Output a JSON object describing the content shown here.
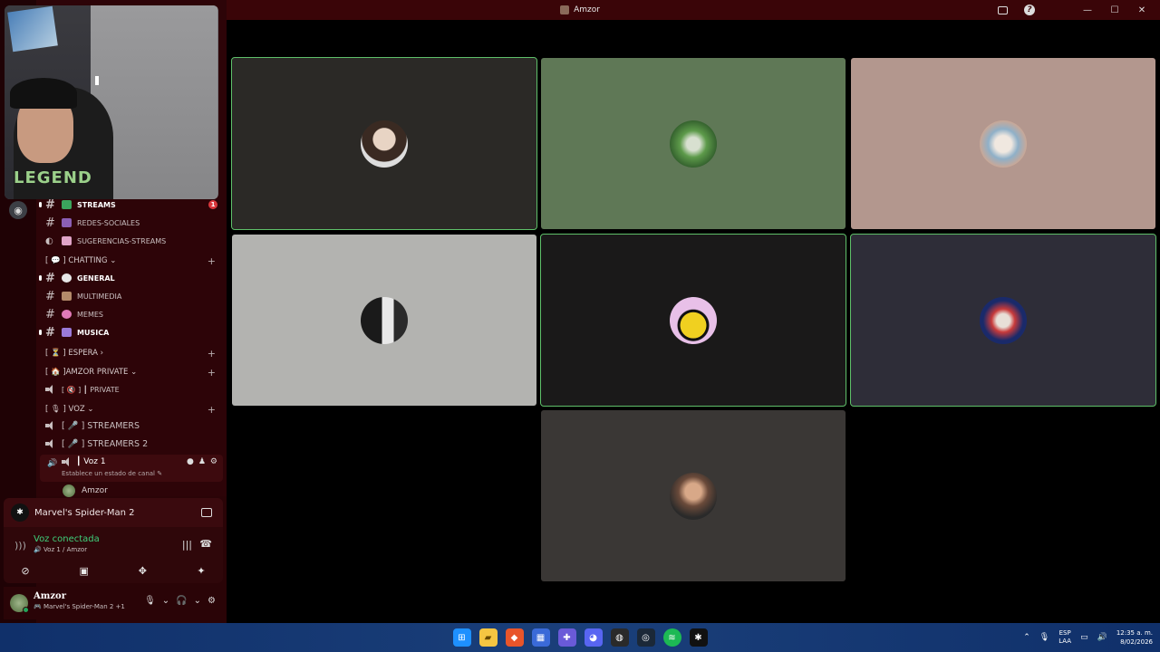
{
  "window": {
    "title": "Amzor"
  },
  "sidebar": {
    "channels": [
      {
        "name": "STREAMS",
        "bold": true,
        "badge": "1"
      },
      {
        "name": "REDES-SOCIALES"
      },
      {
        "name": "SUGERENCIAS-STREAMS"
      },
      {
        "name": "GENERAL",
        "bold": true
      },
      {
        "name": "MULTIMEDIA"
      },
      {
        "name": "MEMES"
      },
      {
        "name": "MUSICA",
        "bold": true
      }
    ],
    "categories": {
      "chatting": "[ 💬 ] CHATTING ⌄",
      "espera": "[ ⏳ ] ESPERA ›",
      "amzor_private": "[ 🏠 ]AMZOR PRIVATE ⌄",
      "voz": "[ 🎙 ] VOZ ⌄"
    },
    "voice_channels": {
      "private": "[ 🔇 ] ┃ PRIVATE",
      "streamers": "[ 🎤 ] STREAMERS",
      "streamers2": "[ 🎤 ] STREAMERS 2"
    },
    "active_voice": {
      "name": "┃ Voz 1",
      "status": "Establece un estado de canal ✎",
      "member": "Amzor"
    }
  },
  "activity": {
    "game": "Marvel's Spider-Man 2"
  },
  "voice_panel": {
    "title": "Voz conectada",
    "subtitle": "🔊 Voz 1 / Amzor"
  },
  "user": {
    "name": "Amzor",
    "status": "🎮 Marvel's Spider-Man 2 +1"
  },
  "taskbar": {
    "lang_top": "ESP",
    "lang_bottom": "LAA",
    "time": "12:35 a. m.",
    "date": "8/02/2026"
  },
  "colors": {
    "accent_green": "#3ecf7a",
    "speaking_outline": "#5fc06a",
    "sidebar_bg": "#2d0408",
    "titlebar_bg": "#3a0508"
  }
}
